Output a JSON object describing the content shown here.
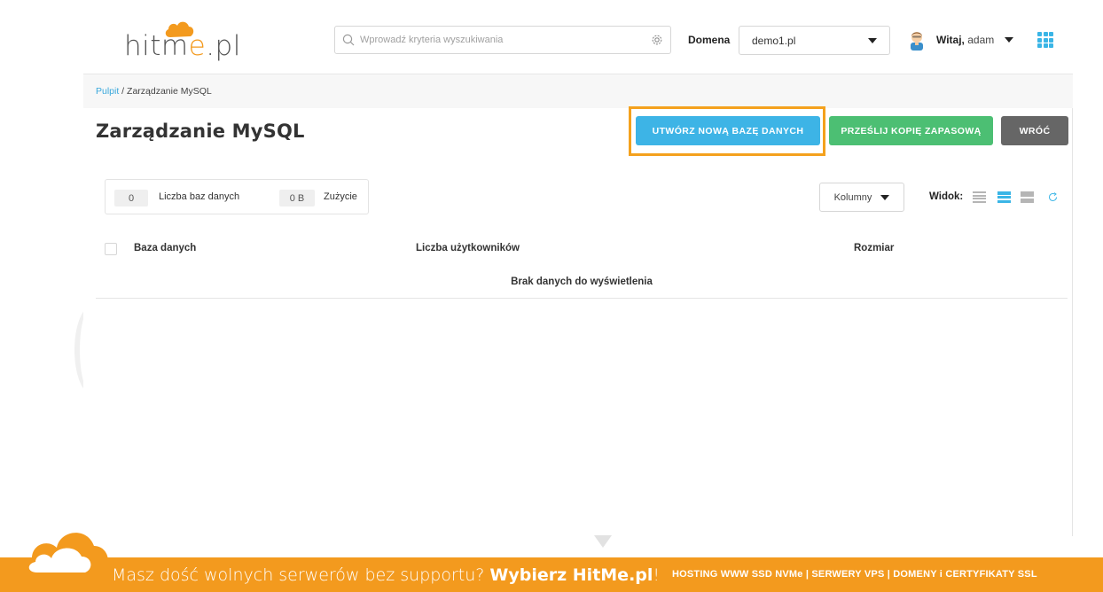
{
  "header": {
    "logo": {
      "text_main": "hitm",
      "text_accent": "e",
      "text_tail": ".pl"
    },
    "search": {
      "placeholder": "Wprowadź kryteria wyszukiwania"
    },
    "domain": {
      "label": "Domena",
      "selected": "demo1.pl"
    },
    "user": {
      "greeting": "Witaj,",
      "name": "adam"
    }
  },
  "breadcrumb": {
    "home": "Pulpit",
    "separator": " / ",
    "current": "Zarządzanie MySQL"
  },
  "page": {
    "title": "Zarządzanie MySQL",
    "buttons": {
      "create": "UTWÓRZ NOWĄ BAZĘ DANYCH",
      "backup": "PRZEŚLIJ KOPIĘ ZAPASOWĄ",
      "back": "WRÓĆ"
    }
  },
  "stats": {
    "db_count": "0",
    "db_count_label": "Liczba baz danych",
    "usage": "0 B",
    "usage_label": "Zużycie"
  },
  "view": {
    "columns_label": "Kolumny",
    "view_label": "Widok:"
  },
  "table": {
    "columns": [
      "Baza danych",
      "Liczba użytkowników",
      "Rozmiar"
    ],
    "empty_message": "Brak danych do wyświetlenia"
  },
  "banner": {
    "slogan_prefix": "Masz dość wolnych serwerów bez supportu? ",
    "slogan_bold": "Wybierz HitMe.pl",
    "slogan_suffix": "!",
    "right_text": "HOSTING WWW SSD NVMe | SERWERY VPS | DOMENY i CERTYFIKATY SSL"
  },
  "colors": {
    "accent_blue": "#3db4e6",
    "accent_green": "#4cbf73",
    "accent_orange": "#f39a1e",
    "button_gray": "#666666"
  },
  "icons": [
    "search-icon",
    "settings-gear-icon",
    "chevron-down-icon",
    "user-avatar-icon",
    "apps-grid-icon",
    "list-view-icon",
    "refresh-icon",
    "cloud-logo-icon"
  ]
}
